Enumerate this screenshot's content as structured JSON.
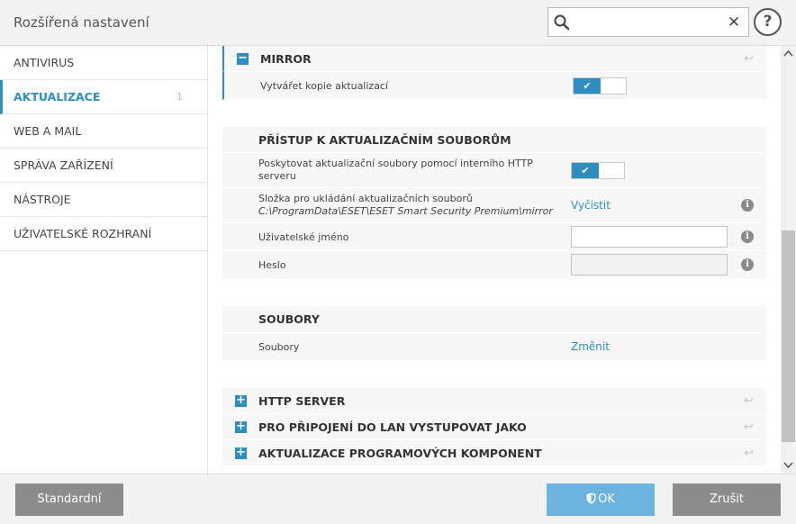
{
  "window": {
    "title": "Rozšířená nastavení"
  },
  "search": {
    "value": "",
    "placeholder": "",
    "icon": "search-icon",
    "clear_glyph": "✕"
  },
  "help": {
    "label": "?"
  },
  "sidebar": {
    "items": [
      {
        "label": "ANTIVIRUS",
        "count": "",
        "active": false
      },
      {
        "label": "AKTUALIZACE",
        "count": "1",
        "active": true
      },
      {
        "label": "WEB A MAIL",
        "count": "",
        "active": false
      },
      {
        "label": "SPRÁVA ZAŘÍZENÍ",
        "count": "",
        "active": false
      },
      {
        "label": "NÁSTROJE",
        "count": "",
        "active": false
      },
      {
        "label": "UŽIVATELSKÉ ROZHRANÍ",
        "count": "",
        "active": false
      }
    ]
  },
  "main": {
    "mirror": {
      "title": "MIRROR",
      "expanded_glyph": "−",
      "create_copies": {
        "label": "Vytvářet kopie aktualizací",
        "enabled": true
      }
    },
    "access": {
      "title": "PŘÍSTUP K AKTUALIZAČNÍM SOUBORŮM",
      "provide_http": {
        "label": "Poskytovat aktualizační soubory pomocí interního HTTP serveru",
        "enabled": true
      },
      "folder": {
        "label": "Složka pro ukládání aktualizačních souborů",
        "path": "C:\\ProgramData\\ESET\\ESET Smart Security Premium\\mirror",
        "action": "Vyčistit"
      },
      "username": {
        "label": "Uživatelské jméno",
        "value": ""
      },
      "password": {
        "label": "Heslo",
        "value": ""
      }
    },
    "files": {
      "title": "SOUBORY",
      "row": {
        "label": "Soubory",
        "action": "Změnit"
      }
    },
    "collapsed_sections": [
      {
        "title": "HTTP SERVER"
      },
      {
        "title": "PRO PŘIPOJENÍ DO LAN VYSTUPOVAT JAKO"
      },
      {
        "title": "AKTUALIZACE PROGRAMOVÝCH KOMPONENT"
      }
    ],
    "collapsed_glyph": "+",
    "info_glyph": "i",
    "check_glyph": "✔",
    "revert_glyph": "↩"
  },
  "footer": {
    "default_label": "Standardní",
    "ok_label": "OK",
    "cancel_label": "Zrušit"
  },
  "colors": {
    "accent": "#2c8fbf",
    "ok_button": "#6cb3e0",
    "grey_button": "#8c8c8c"
  }
}
